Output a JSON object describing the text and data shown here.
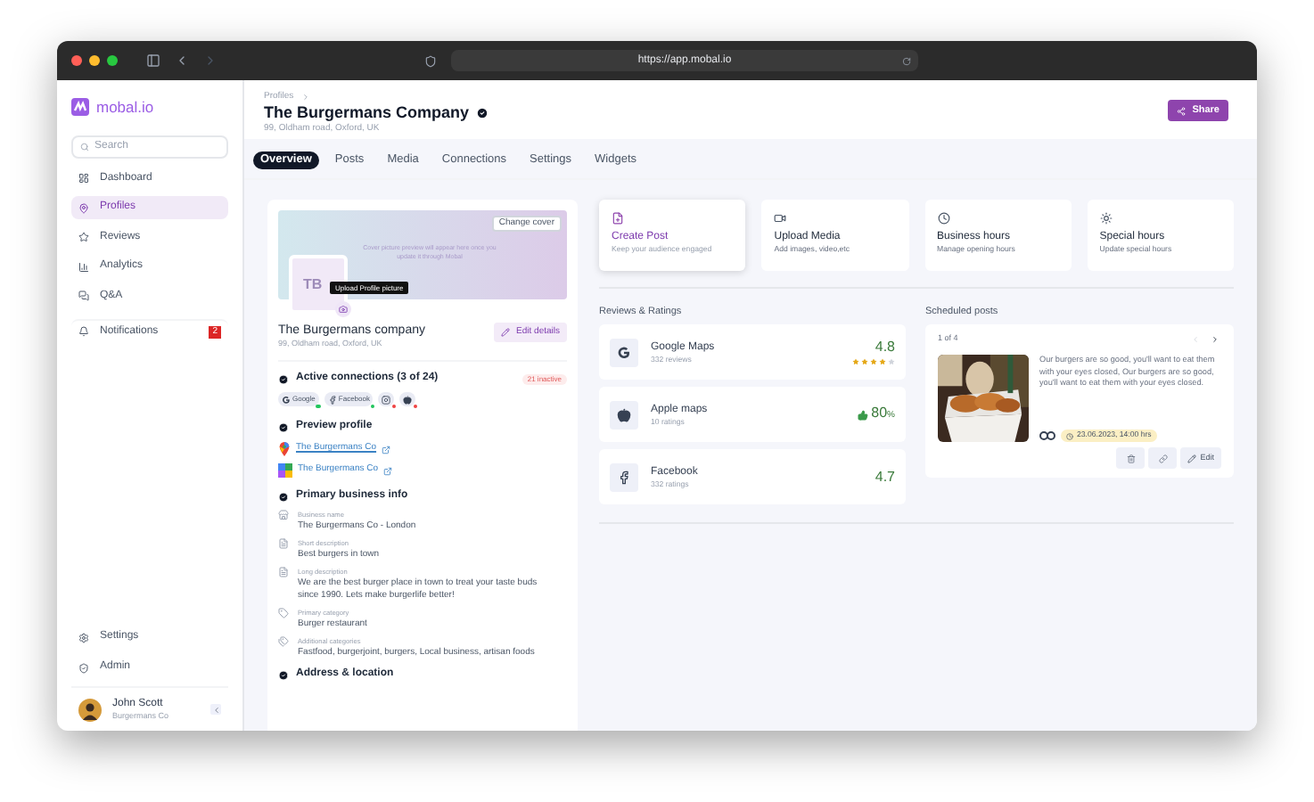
{
  "browser": {
    "url": "https://app.mobal.io"
  },
  "sidebar": {
    "logo": "mobal.io",
    "search": {
      "placeholder": "Search"
    },
    "items": [
      {
        "label": "Dashboard",
        "kind": "dashboard",
        "selected": false
      },
      {
        "label": "Profiles",
        "kind": "profiles",
        "selected": true
      },
      {
        "label": "Reviews",
        "kind": "reviews",
        "selected": false
      },
      {
        "label": "Analytics",
        "kind": "analytics",
        "selected": false
      },
      {
        "label": "Q&A",
        "kind": "qa",
        "selected": false
      },
      {
        "label": "Notifications",
        "kind": "notifications",
        "selected": false,
        "badge": "2"
      }
    ],
    "bottom_items": [
      {
        "label": "Settings",
        "kind": "settings"
      },
      {
        "label": "Admin",
        "kind": "admin"
      }
    ],
    "user": {
      "name": "John Scott",
      "company": "Burgermans Co"
    }
  },
  "header": {
    "breadcrumb": "Profiles",
    "title": "The Burgermans Company",
    "address": "99, Oldham road, Oxford, UK",
    "share_button": "Share"
  },
  "tabs": [
    {
      "label": "Overview",
      "selected": true
    },
    {
      "label": "Posts",
      "selected": false
    },
    {
      "label": "Media",
      "selected": false
    },
    {
      "label": "Connections",
      "selected": false
    },
    {
      "label": "Settings",
      "selected": false
    },
    {
      "label": "Widgets",
      "selected": false
    }
  ],
  "profile_card": {
    "cover_text": "Cover picture preview will appear here once you update it through Mobal",
    "change_cover": "Change cover",
    "avatar_text": "TB",
    "tooltip": "Upload Profile picture",
    "name": "The Burgermans company",
    "address": "99, Oldham road, Oxford, UK",
    "edit_button": "Edit details",
    "connections": {
      "title": "Active connections (3 of 24)",
      "badge": "21 inactive",
      "chips": [
        {
          "kind": "google",
          "label": "Google",
          "color": "#22c55e"
        },
        {
          "kind": "facebook",
          "label": "Facebook",
          "color": "#22c55e"
        },
        {
          "kind": "instagram",
          "color": "#ef4444"
        },
        {
          "kind": "apple",
          "color": "#ef4444"
        }
      ]
    },
    "preview": {
      "title": "Preview profile",
      "links": [
        {
          "kind": "google",
          "label": "The Burgermans Co",
          "underlined": true
        },
        {
          "kind": "bing",
          "label": "The Burgermans Co",
          "underlined": false
        }
      ]
    },
    "info": {
      "title": "Primary business info",
      "fields": [
        {
          "kind": "store",
          "label": "Business name",
          "value": "The Burgermans Co - London"
        },
        {
          "kind": "doc",
          "label": "Short description",
          "value": "Best burgers in town"
        },
        {
          "kind": "doc",
          "label": "Long description",
          "value": "We are the best burger place in town to treat your taste buds since 1990. Lets make burgerlife better!"
        },
        {
          "kind": "tag",
          "label": "Primary category",
          "value": "Burger restaurant"
        },
        {
          "kind": "tags",
          "label": "Additional categories",
          "value": "Fastfood, burgerjoint, burgers, Local business, artisan foods"
        }
      ]
    },
    "address_title": "Address & location"
  },
  "actions": [
    {
      "kind": "post",
      "title": "Create Post",
      "subtitle": "Keep your audience engaged",
      "selected": true
    },
    {
      "kind": "media",
      "title": "Upload Media",
      "subtitle": "Add images, video,etc",
      "selected": false
    },
    {
      "kind": "hours",
      "title": "Business hours",
      "subtitle": "Manage opening hours",
      "selected": false
    },
    {
      "kind": "special",
      "title": "Special hours",
      "subtitle": "Update special hours",
      "selected": false
    }
  ],
  "reviews": {
    "title": "Reviews & Ratings",
    "items": [
      {
        "kind": "google",
        "name": "Google Maps",
        "count": "332 reviews",
        "score": "4.8",
        "stars": 4
      },
      {
        "kind": "apple",
        "name": "Apple maps",
        "count": "10 ratings",
        "score": "80",
        "unit": "%"
      },
      {
        "kind": "facebook",
        "name": "Facebook",
        "count": "332 ratings",
        "score": "4.7"
      }
    ]
  },
  "scheduled": {
    "title": "Scheduled posts",
    "counter": "1 of 4",
    "text": "Our burgers are so good, you'll want to eat them with your eyes closed, Our burgers are so good, you'll want to eat them with your eyes closed.",
    "date": "23.06.2023, 14:00 hrs",
    "edit_button": "Edit"
  }
}
